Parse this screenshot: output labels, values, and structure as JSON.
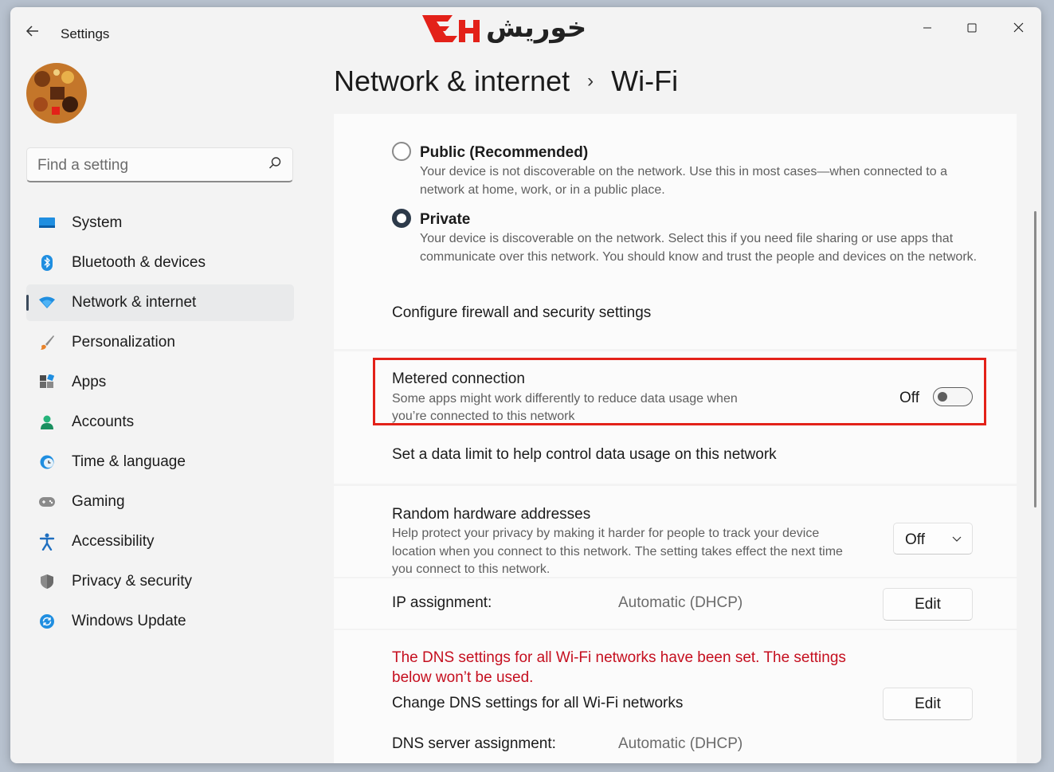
{
  "window": {
    "title": "Settings",
    "logo_text": "خوریش"
  },
  "sidebar": {
    "search_placeholder": "Find a setting",
    "items": [
      {
        "label": "System",
        "icon": "monitor-icon"
      },
      {
        "label": "Bluetooth & devices",
        "icon": "bluetooth-icon"
      },
      {
        "label": "Network & internet",
        "icon": "wifi-icon",
        "active": true
      },
      {
        "label": "Personalization",
        "icon": "brush-icon"
      },
      {
        "label": "Apps",
        "icon": "apps-icon"
      },
      {
        "label": "Accounts",
        "icon": "person-icon"
      },
      {
        "label": "Time & language",
        "icon": "clock-globe-icon"
      },
      {
        "label": "Gaming",
        "icon": "gamepad-icon"
      },
      {
        "label": "Accessibility",
        "icon": "accessibility-icon"
      },
      {
        "label": "Privacy & security",
        "icon": "shield-icon"
      },
      {
        "label": "Windows Update",
        "icon": "update-icon"
      }
    ]
  },
  "breadcrumb": {
    "parent": "Network & internet",
    "separator": "›",
    "current": "Wi-Fi"
  },
  "network_profile": {
    "public_title": "Public (Recommended)",
    "public_desc": "Your device is not discoverable on the network. Use this in most cases—when connected to a network at home, work, or in a public place.",
    "private_title": "Private",
    "private_desc": "Your device is discoverable on the network. Select this if you need file sharing or use apps that communicate over this network. You should know and trust the people and devices on the network.",
    "selected": "Private",
    "firewall_link": "Configure firewall and security settings"
  },
  "metered": {
    "title": "Metered connection",
    "desc_line1": "Some apps might work differently to reduce data usage when",
    "desc_line2": "you’re connected to this network",
    "state_label": "Off",
    "data_limit_link": "Set a data limit to help control data usage on this network"
  },
  "random_hw": {
    "title": "Random hardware addresses",
    "desc": "Help protect your privacy by making it harder for people to track your device location when you connect to this network. The setting takes effect the next time you connect to this network.",
    "value": "Off"
  },
  "ip": {
    "label": "IP assignment:",
    "value": "Automatic (DHCP)",
    "button": "Edit"
  },
  "dns": {
    "warning": "The DNS settings for all Wi-Fi networks have been set. The settings below won’t be used.",
    "change_label": "Change DNS settings for all Wi-Fi networks",
    "button": "Edit",
    "server_label": "DNS server assignment:",
    "server_value": "Automatic (DHCP)"
  },
  "colors": {
    "accent": "#0067c0",
    "highlight_box": "#e32119",
    "warning_text": "#c50f1f"
  }
}
